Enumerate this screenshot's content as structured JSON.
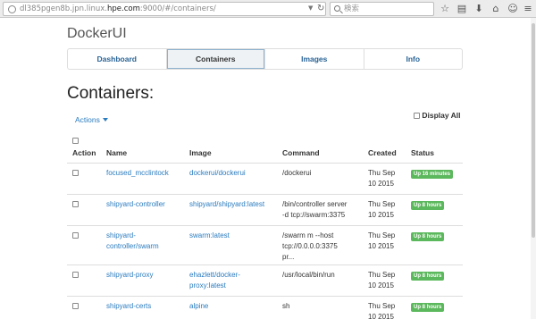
{
  "browser": {
    "url_prefix": "dl385pgen8b.jpn.linux.",
    "url_host": "hpe.com",
    "url_suffix": ":9000/#/containers/",
    "search_placeholder": "検索"
  },
  "app": {
    "brand": "DockerUI",
    "nav": [
      "Dashboard",
      "Containers",
      "Images",
      "Info"
    ],
    "active_nav": "Containers",
    "heading": "Containers:",
    "actions_label": "Actions",
    "display_all_label": "Display All"
  },
  "table": {
    "columns": [
      "Action",
      "Name",
      "Image",
      "Command",
      "Created",
      "Status"
    ],
    "rows": [
      {
        "name": [
          "focused_mcclintock"
        ],
        "image": [
          "dockerui/dockerui"
        ],
        "command": [
          "/dockerui"
        ],
        "created": [
          "Thu Sep",
          "10 2015"
        ],
        "status": "Up 16 minutes"
      },
      {
        "name": [
          "shipyard-controller"
        ],
        "image": [
          "shipyard/shipyard:latest"
        ],
        "command": [
          "/bin/controller server",
          "-d tcp://swarm:3375"
        ],
        "created": [
          "Thu Sep",
          "10 2015"
        ],
        "status": "Up 8 hours"
      },
      {
        "name": [
          "shipyard-",
          "controller/swarm"
        ],
        "image": [
          "swarm:latest"
        ],
        "command": [
          "/swarm m --host",
          "tcp://0.0.0.0:3375",
          "pr..."
        ],
        "created": [
          "Thu Sep",
          "10 2015"
        ],
        "status": "Up 8 hours"
      },
      {
        "name": [
          "shipyard-proxy"
        ],
        "image": [
          "ehazlett/docker-",
          "proxy:latest"
        ],
        "command": [
          "/usr/local/bin/run"
        ],
        "created": [
          "Thu Sep",
          "10 2015"
        ],
        "status": "Up 8 hours"
      },
      {
        "name": [
          "shipyard-certs"
        ],
        "image": [
          "alpine"
        ],
        "command": [
          "sh"
        ],
        "created": [
          "Thu Sep",
          "10 2015"
        ],
        "status": "Up 8 hours"
      }
    ]
  }
}
